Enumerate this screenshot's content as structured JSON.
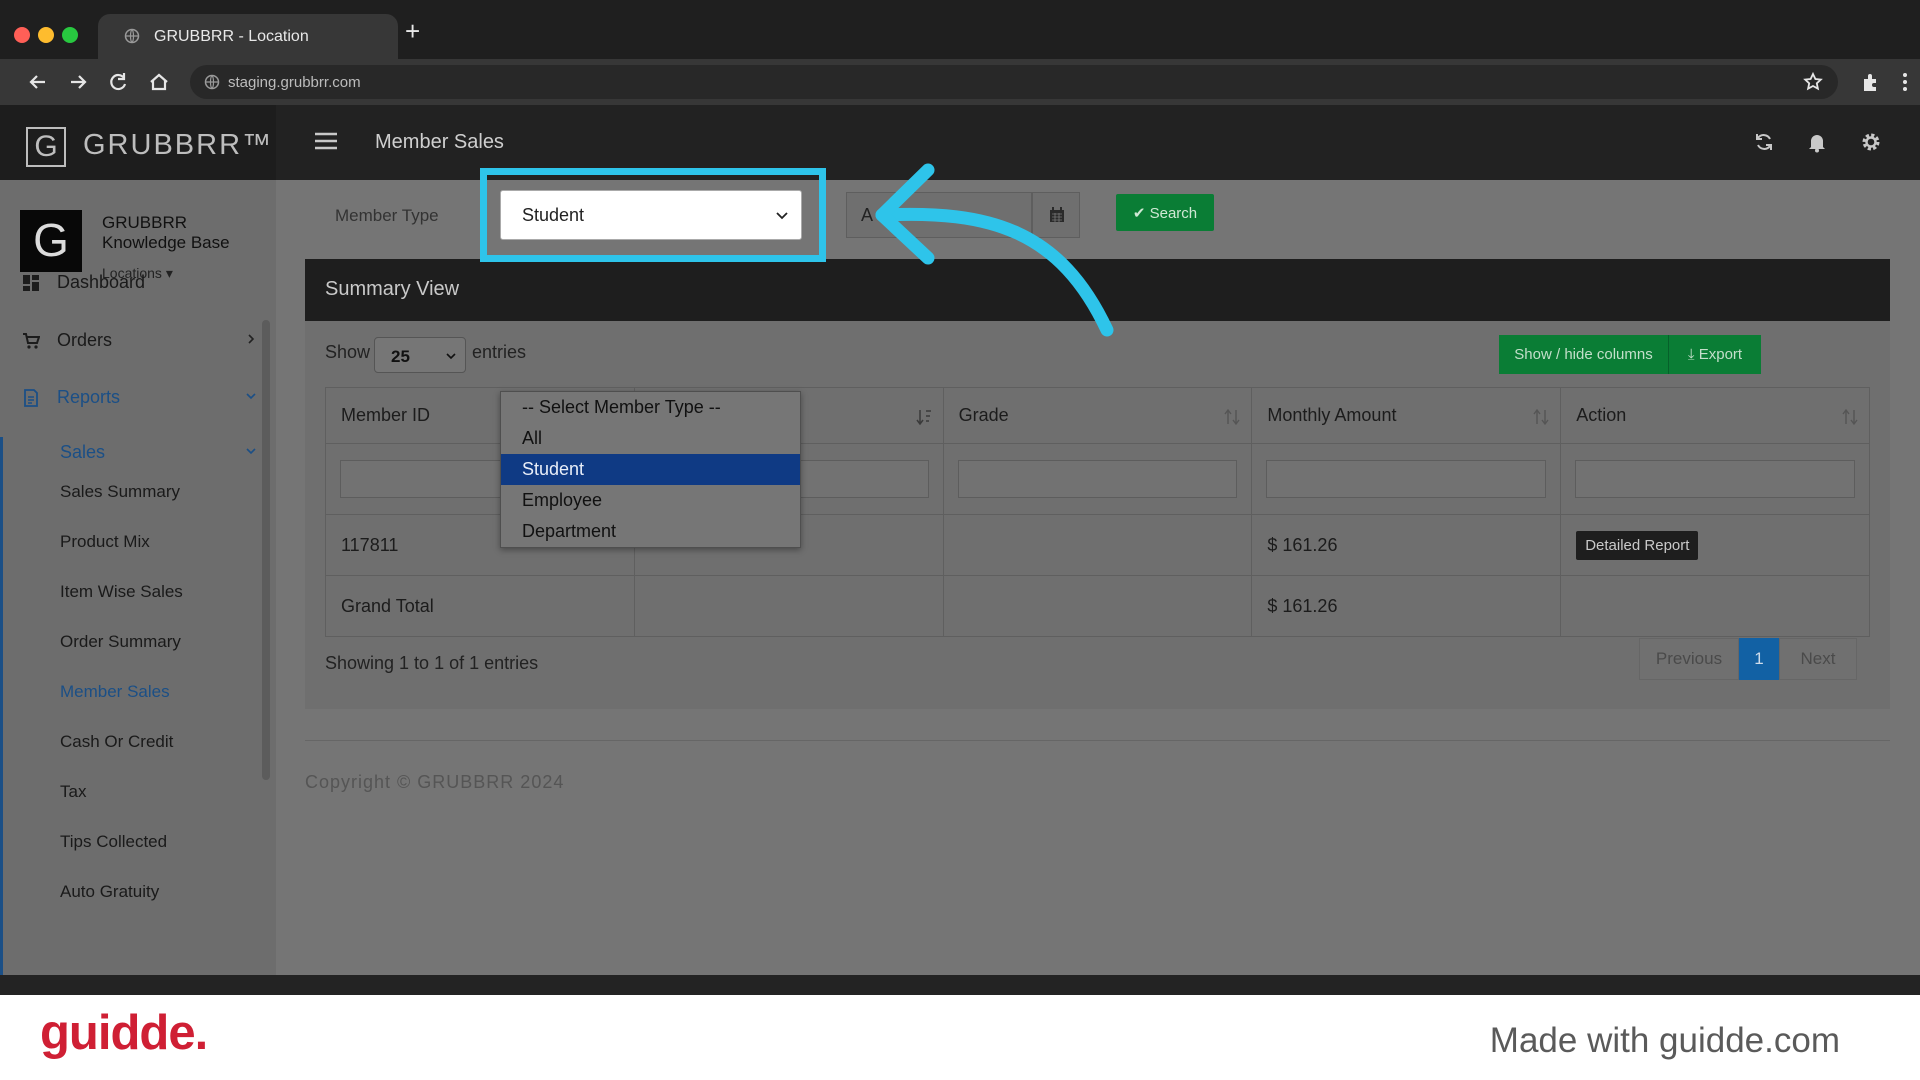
{
  "browser": {
    "tab_title": "GRUBBRR - Location",
    "new_tab": "+",
    "url": "staging.grubbrr.com",
    "traffic_colors": [
      "#ff5f57",
      "#febc2e",
      "#28c840"
    ]
  },
  "header": {
    "logo_mark": "G",
    "logo_text": "GRUBBRR™",
    "page_title": "Member Sales"
  },
  "sidebar": {
    "avatar_letter": "G",
    "org_line1": "GRUBBRR",
    "org_line2": "Knowledge Base",
    "locations": "Locations ▾",
    "items": [
      {
        "label": "Dashboard",
        "icon": "dashboard-icon"
      },
      {
        "label": "Orders",
        "icon": "cart-icon"
      },
      {
        "label": "Reports",
        "icon": "report-icon"
      }
    ],
    "sales_label": "Sales",
    "sub_items": [
      "Sales Summary",
      "Product Mix",
      "Item Wise Sales",
      "Order Summary",
      "Member Sales",
      "Cash Or Credit",
      "Tax",
      "Tips Collected",
      "Auto Gratuity"
    ],
    "active_color": "#1b4f86"
  },
  "filters": {
    "member_type_label": "Member Type",
    "member_type_value": "Student",
    "date_value": "A",
    "search_label": "✔ Search"
  },
  "dropdown": {
    "options": [
      "-- Select Member Type --",
      "All",
      "Student",
      "Employee",
      "Department"
    ],
    "selected": "Student"
  },
  "panel": {
    "title": "Summary View",
    "show_label": "Show",
    "entries_value": "25",
    "entries_label": "entries",
    "show_hide_label": "Show / hide columns",
    "export_label": "⤓ Export",
    "columns": [
      "Member ID",
      "",
      "Grade",
      "Monthly Amount",
      "Action"
    ],
    "rows": [
      {
        "member_id": "117811",
        "col2": "",
        "grade": "",
        "amount": "$ 161.26",
        "action": "Detailed Report"
      }
    ],
    "total_label": "Grand Total",
    "total_amount": "$ 161.26",
    "showing": "Showing 1 to 1 of 1 entries",
    "pagination": {
      "prev": "Previous",
      "page": "1",
      "next": "Next"
    }
  },
  "footer": {
    "copyright": "Copyright © GRUBBRR 2024"
  },
  "guidde": {
    "logo": "guidde.",
    "made_with": "Made with guidde.com"
  },
  "colors": {
    "highlight": "#2ec4ea",
    "green_button": "#0a7d35",
    "guidde_red": "#cf1f34"
  }
}
